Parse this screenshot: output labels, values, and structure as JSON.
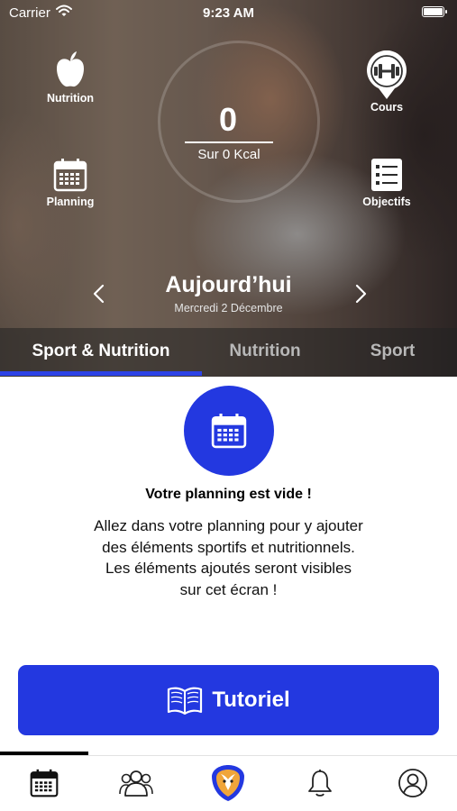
{
  "status_bar": {
    "carrier": "Carrier",
    "time": "9:23 AM"
  },
  "hero": {
    "nutrition_label": "Nutrition",
    "cours_label": "Cours",
    "planning_label": "Planning",
    "objectifs_label": "Objectifs",
    "kcal_value": "0",
    "kcal_target": "Sur 0 Kcal",
    "day_title": "Aujourd’hui",
    "day_date": "Mercredi 2 Décembre"
  },
  "tabs": [
    {
      "label": "Sport & Nutrition",
      "active": true
    },
    {
      "label": "Nutrition",
      "active": false
    },
    {
      "label": "Sport",
      "active": false
    }
  ],
  "empty_state": {
    "icon": "calendar-icon",
    "title": "Votre planning est vide !",
    "line1": "Allez dans votre planning pour y ajouter",
    "line2": "des éléments sportifs et nutritionnels.",
    "line3": "Les éléments ajoutés seront visibles",
    "line4": "sur cet écran !"
  },
  "tutorial_button": {
    "label": "Tutoriel",
    "icon": "open-book-icon"
  },
  "tab_bar": {
    "items": [
      "calendar-icon",
      "community-icon",
      "app-logo-icon",
      "bell-icon",
      "profile-icon"
    ],
    "active": "calendar-icon"
  },
  "colors": {
    "accent": "#2338e0",
    "tab_underline": "#2d43e6"
  }
}
